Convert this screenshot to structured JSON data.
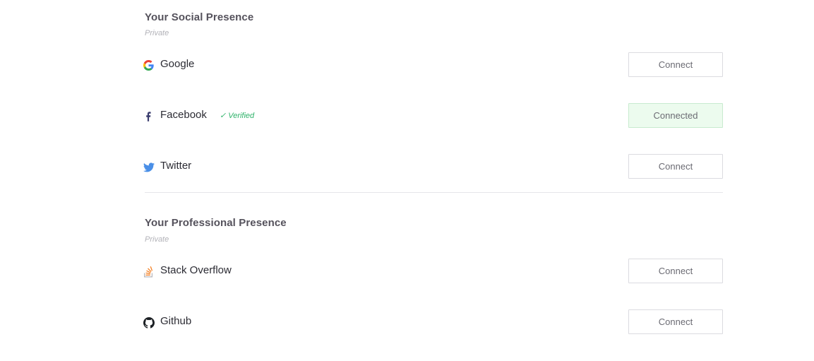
{
  "social": {
    "title": "Your Social Presence",
    "subtitle": "Private",
    "items": [
      {
        "name": "Google",
        "icon": "google-icon",
        "button": "Connect",
        "verified": ""
      },
      {
        "name": "Facebook",
        "icon": "facebook-icon",
        "button": "Connected",
        "verified": "✓ Verified"
      },
      {
        "name": "Twitter",
        "icon": "twitter-icon",
        "button": "Connect",
        "verified": ""
      }
    ]
  },
  "professional": {
    "title": "Your Professional Presence",
    "subtitle": "Private",
    "items": [
      {
        "name": "Stack Overflow",
        "icon": "stack-overflow-icon",
        "button": "Connect"
      },
      {
        "name": "Github",
        "icon": "github-icon",
        "button": "Connect"
      }
    ]
  },
  "colors": {
    "verified": "#2fb36a",
    "connected_bg": "#ecfbee",
    "heading": "#55525c",
    "muted": "#b2b2b8"
  }
}
